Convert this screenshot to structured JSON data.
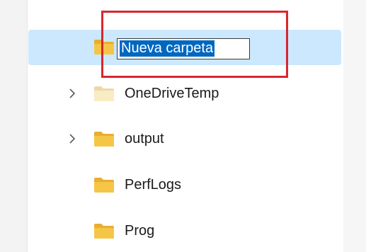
{
  "rename": {
    "value": "Nueva carpeta"
  },
  "tree": {
    "items": [
      {
        "label": "OneDriveTemp",
        "expandable": true,
        "icon": "folder-icon"
      },
      {
        "label": "output",
        "expandable": true,
        "icon": "folder-icon"
      },
      {
        "label": "PerfLogs",
        "expandable": false,
        "icon": "folder-icon"
      },
      {
        "label": "Prog",
        "expandable": false,
        "icon": "folder-icon"
      }
    ]
  },
  "colors": {
    "selection": "#cce8ff",
    "text_highlight": "#0067c0",
    "annotation": "#d9262e",
    "folder": "#f5c646"
  }
}
